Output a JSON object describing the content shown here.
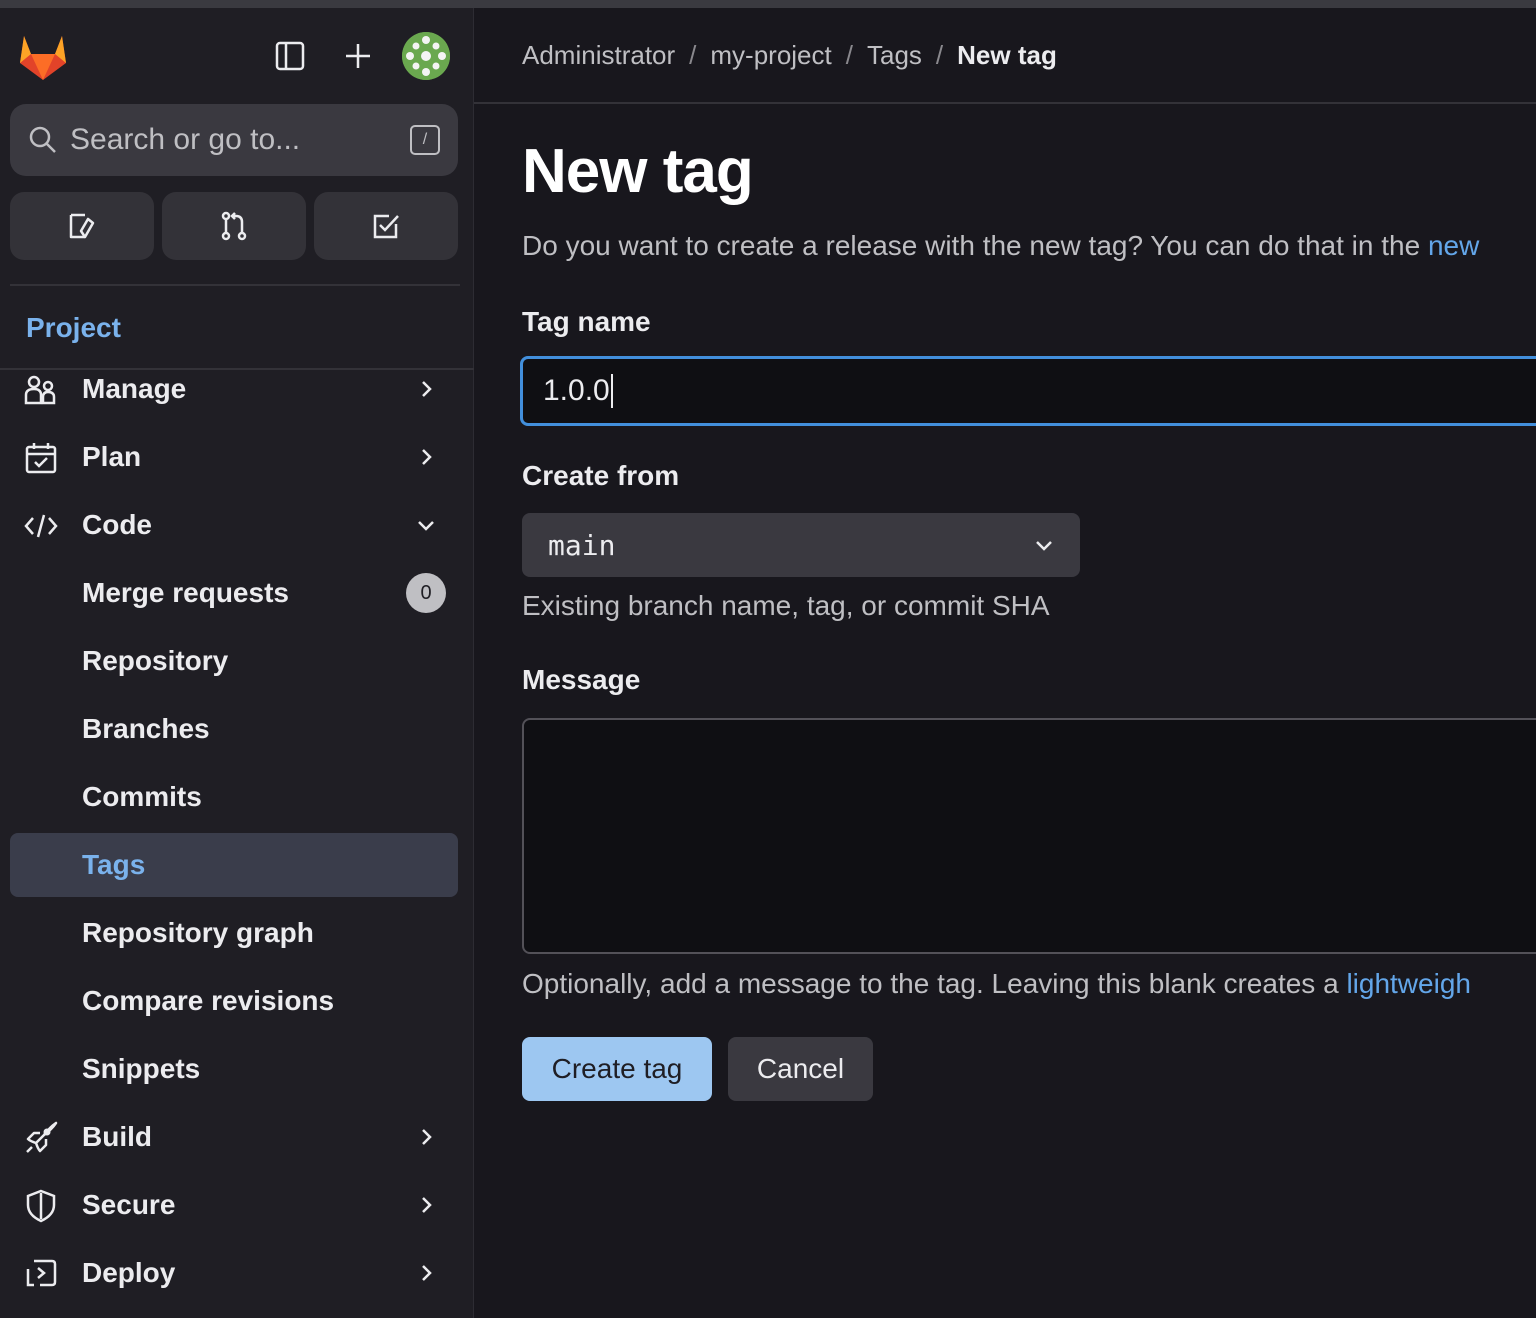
{
  "sidebar": {
    "search_placeholder": "Search or go to...",
    "search_shortcut": "/",
    "section_title": "Project",
    "items": [
      {
        "label": "Manage",
        "icon": "users-icon",
        "chevron": "right"
      },
      {
        "label": "Plan",
        "icon": "calendar-icon",
        "chevron": "right"
      },
      {
        "label": "Code",
        "icon": "code-icon",
        "chevron": "down"
      },
      {
        "label": "Merge requests",
        "badge": "0"
      },
      {
        "label": "Repository"
      },
      {
        "label": "Branches"
      },
      {
        "label": "Commits"
      },
      {
        "label": "Tags",
        "active": true
      },
      {
        "label": "Repository graph"
      },
      {
        "label": "Compare revisions"
      },
      {
        "label": "Snippets"
      },
      {
        "label": "Build",
        "icon": "rocket-icon",
        "chevron": "right"
      },
      {
        "label": "Secure",
        "icon": "shield-icon",
        "chevron": "right"
      },
      {
        "label": "Deploy",
        "icon": "deploy-icon",
        "chevron": "right"
      }
    ]
  },
  "breadcrumb": [
    "Administrator",
    "my-project",
    "Tags",
    "New tag"
  ],
  "page": {
    "title": "New tag",
    "description": "Do you want to create a release with the new tag? You can do that in the ",
    "description_link": "new"
  },
  "form": {
    "tag_name_label": "Tag name",
    "tag_name_value": "1.0.0",
    "create_from_label": "Create from",
    "create_from_value": "main",
    "create_from_help": "Existing branch name, tag, or commit SHA",
    "message_label": "Message",
    "message_value": "",
    "message_help": "Optionally, add a message to the tag. Leaving this blank creates a ",
    "message_help_link": "lightweigh",
    "create_button": "Create tag",
    "cancel_button": "Cancel"
  },
  "colors": {
    "accent": "#428fdc",
    "link": "#63a6e9",
    "primary_button": "#9dc7f1",
    "logo_orange": "#fc6d26"
  }
}
